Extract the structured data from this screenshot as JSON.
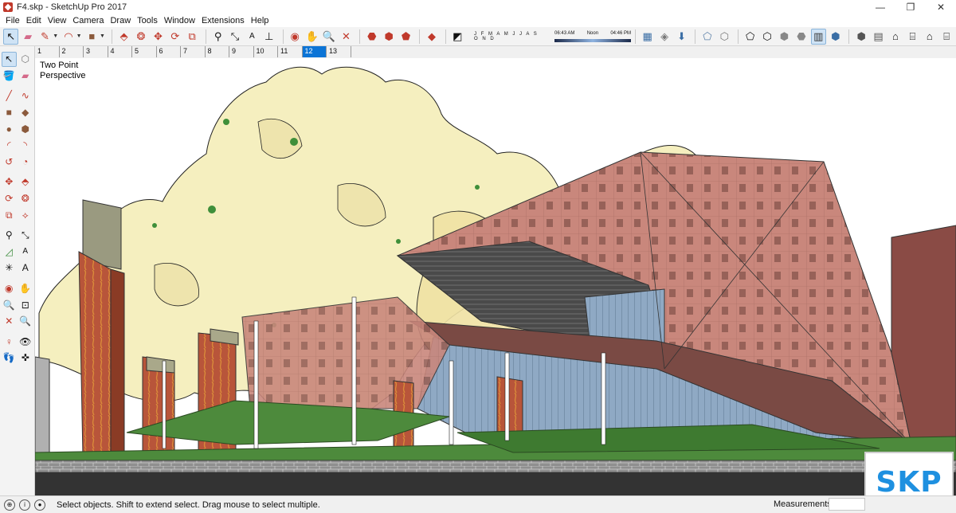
{
  "window": {
    "title": "F4.skp - SketchUp Pro 2017",
    "minimize_glyph": "—",
    "maximize_glyph": "❐",
    "close_glyph": "✕"
  },
  "menu": [
    "File",
    "Edit",
    "View",
    "Camera",
    "Draw",
    "Tools",
    "Window",
    "Extensions",
    "Help"
  ],
  "toolbar": {
    "shadow_months": "J F M A M J J A S O N D",
    "time_start": "06:43 AM",
    "time_mid": "Noon",
    "time_end": "04:46 PM",
    "icons": [
      "select-icon",
      "eraser-icon",
      "pencil-icon",
      "arc-icon",
      "rectangle-icon",
      "push-pull-icon",
      "follow-me-icon",
      "move-icon",
      "rotate-icon",
      "scale-icon",
      "tape-measure-icon",
      "dimension-icon",
      "text-icon",
      "orbit-icon",
      "pan-icon",
      "zoom-icon",
      "zoom-extents-icon",
      "warehouse-icon",
      "extension-warehouse-icon",
      "layout-icon",
      "components-icon",
      "styles-icon",
      "shadows-icon",
      "xray-icon",
      "back-edges-icon",
      "wireframe-icon",
      "hidden-line-icon",
      "shaded-icon",
      "shaded-textures-icon",
      "monochrome-icon",
      "iso-view-icon",
      "top-view-icon",
      "front-view-icon",
      "right-view-icon",
      "back-view-icon",
      "left-view-icon"
    ]
  },
  "scenes": {
    "tabs": [
      "1",
      "2",
      "3",
      "4",
      "5",
      "6",
      "7",
      "8",
      "9",
      "10",
      "11",
      "12",
      "13"
    ],
    "active": "12"
  },
  "viewport": {
    "camera_label": "Two Point\nPerspective",
    "badge": "SKP",
    "colors": {
      "tree_fill": "#f5efbf",
      "facade": "#c9877c",
      "facade_dark": "#8e5a52",
      "glass": "#8fa9c4",
      "grass": "#4d8a3c",
      "road": "#333333",
      "column_brick": "#b8553a"
    }
  },
  "status": {
    "hint": "Select objects. Shift to extend select. Drag mouse to select multiple.",
    "measurements_label": "Measurements",
    "measurements_value": ""
  }
}
